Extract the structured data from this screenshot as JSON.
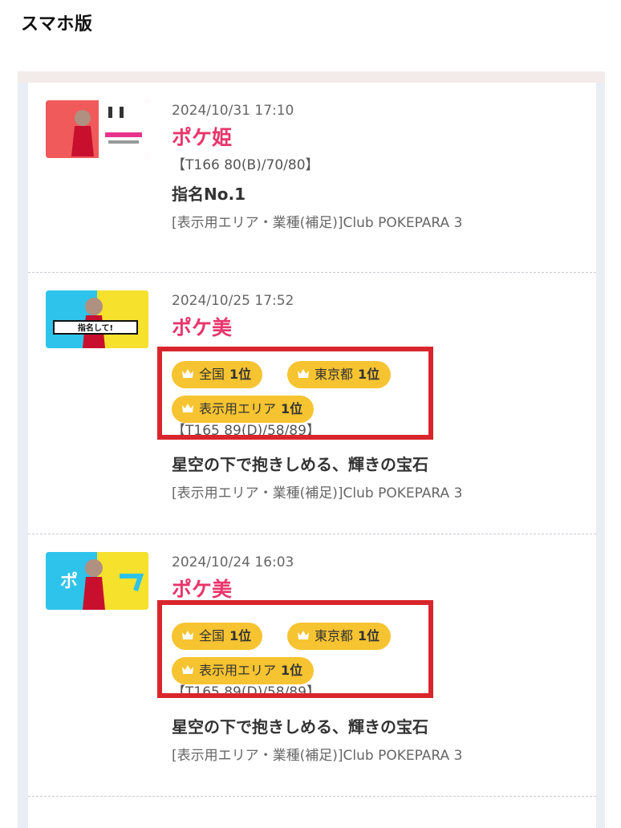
{
  "page": {
    "section_title": "スマホ版"
  },
  "items": [
    {
      "date": "2024/10/31 17:10",
      "name": "ポケ姫",
      "spec": "【T166 80(B)/70/80】",
      "catch": "指名No.1",
      "shop": "[表示用エリア・業種(補足)]Club POKEPARA 3"
    },
    {
      "date": "2024/10/25 17:52",
      "name": "ポケ美",
      "spec": "【T165 89(D)/58/89】",
      "catch": "星空の下で抱きしめる、輝きの宝石",
      "shop": "[表示用エリア・業種(補足)]Club POKEPARA 3",
      "badges": [
        {
          "label": "全国",
          "rank": "1位"
        },
        {
          "label": "東京都",
          "rank": "1位"
        },
        {
          "label": "表示用エリア",
          "rank": "1位"
        }
      ]
    },
    {
      "date": "2024/10/24 16:03",
      "name": "ポケ美",
      "spec": "【T165 89(D)/58/89】",
      "catch": "星空の下で抱きしめる、輝きの宝石",
      "shop": "[表示用エリア・業種(補足)]Club POKEPARA 3",
      "badges": [
        {
          "label": "全国",
          "rank": "1位"
        },
        {
          "label": "東京都",
          "rank": "1位"
        },
        {
          "label": "表示用エリア",
          "rank": "1位"
        }
      ]
    }
  ],
  "thumbs": [
    {
      "banner_text": ""
    },
    {
      "banner_text": "指名して!"
    },
    {
      "banner_text": "ポ"
    }
  ],
  "colors": {
    "name_pink": "#e8356b",
    "badge_yellow": "#f6c331",
    "highlight_red": "#d9262c"
  },
  "icons": {
    "badge_icon": "crown-icon"
  }
}
